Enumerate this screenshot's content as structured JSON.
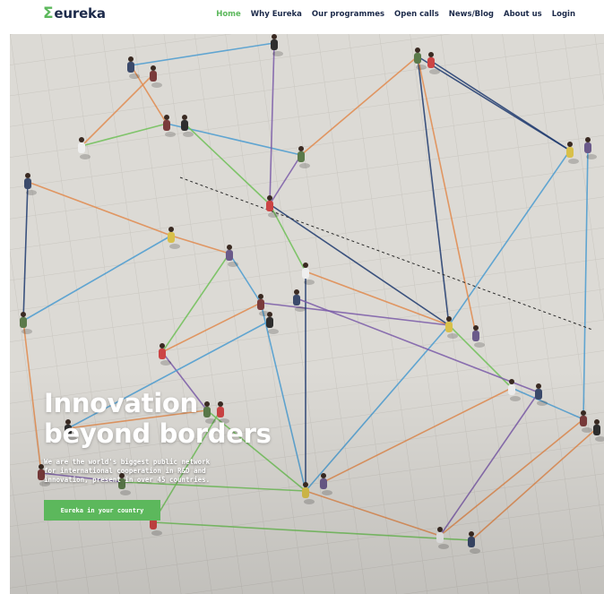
{
  "brand": {
    "name": "eureka",
    "sigma": "Σ",
    "accent_color": "#5cb85c",
    "navy_color": "#1c2a4a"
  },
  "nav": {
    "items": [
      {
        "label": "Home",
        "active": true
      },
      {
        "label": "Why Eureka",
        "active": false
      },
      {
        "label": "Our programmes",
        "active": false
      },
      {
        "label": "Open calls",
        "active": false
      },
      {
        "label": "News/Blog",
        "active": false
      },
      {
        "label": "About us",
        "active": false
      },
      {
        "label": "Login",
        "active": false
      }
    ]
  },
  "hero": {
    "headline_line1": "Innovation",
    "headline_line2": "beyond borders",
    "subtext_line1": "We are the world's biggest public network",
    "subtext_line2": "for international cooperation in R&D and",
    "subtext_line3": "innovation, present in over 45 countries.",
    "cta_label": "Eureka in your country",
    "line_colors": [
      "#e08a4e",
      "#4a9bd0",
      "#6fbf57",
      "#7a5aa8",
      "#1e3a6e"
    ]
  }
}
